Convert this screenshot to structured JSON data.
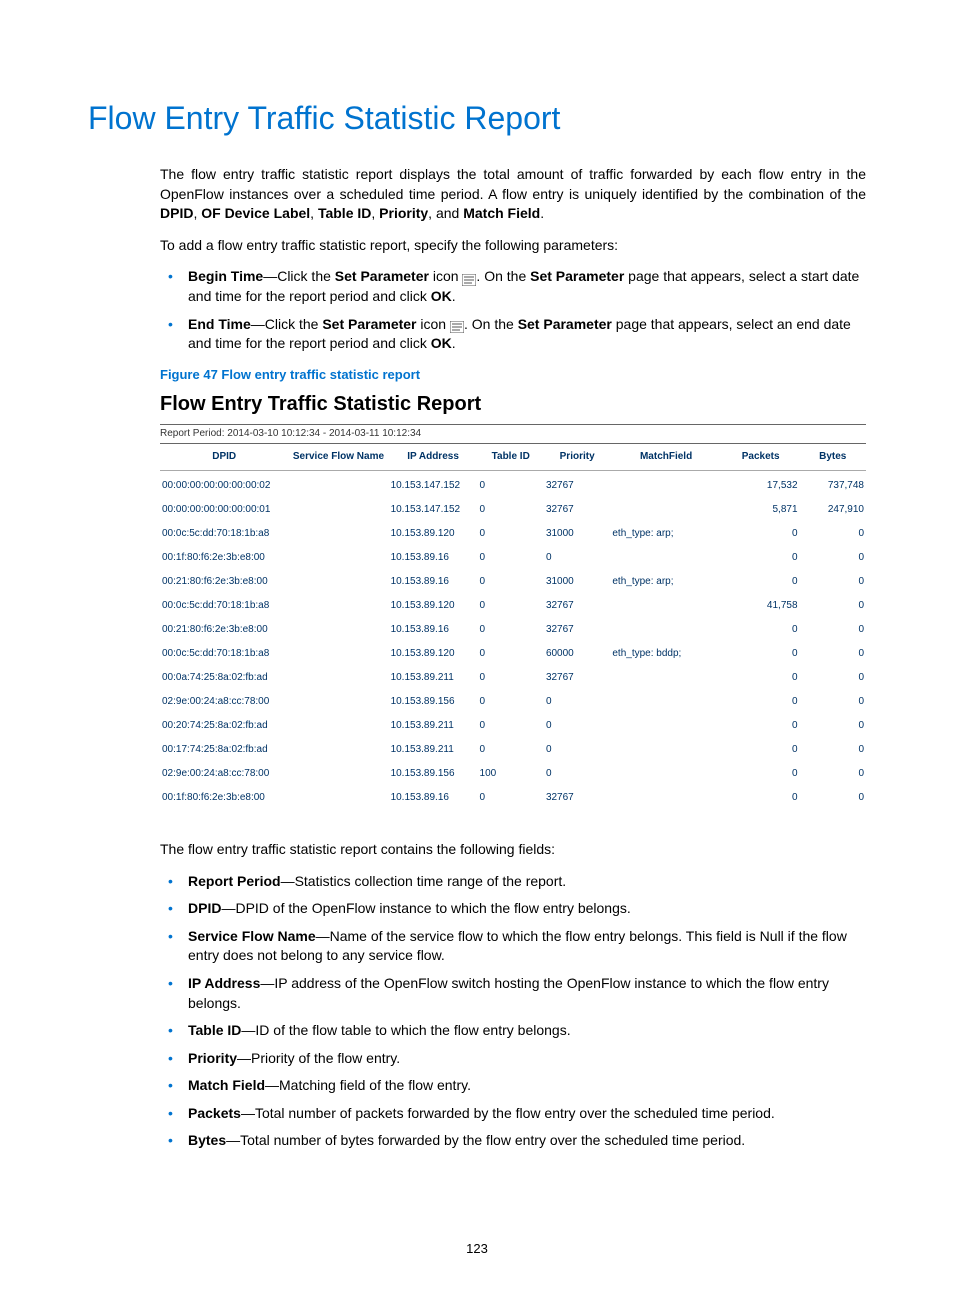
{
  "page_number": "123",
  "title": "Flow Entry Traffic Statistic Report",
  "intro_text": "The flow entry traffic statistic report displays the total amount of traffic forwarded by each flow entry in the OpenFlow instances over a scheduled time period. A flow entry is uniquely identified by the combination of the ",
  "intro_bold": [
    "DPID",
    "OF Device Label",
    "Table ID",
    "Priority",
    "Match Field"
  ],
  "intro_sep": [
    ", ",
    ", ",
    ", ",
    ", and ",
    "."
  ],
  "add_intro": "To add a flow entry traffic statistic report, specify the following parameters:",
  "params": {
    "begin": {
      "label": "Begin Time",
      "text1": "—Click the ",
      "text2": " icon ",
      "text3": ". On the ",
      "text4": " page that appears, select a start date and time for the report period and click ",
      "bold1": "Set Parameter",
      "bold2": "Set Parameter",
      "bold3": "OK",
      "end": "."
    },
    "end": {
      "label": "End Time",
      "text1": "—Click the ",
      "text2": " icon ",
      "text3": ". On the ",
      "text4": " page that appears, select an end date and time for the report period and click ",
      "bold1": "Set Parameter",
      "bold2": "Set Parameter",
      "bold3": "OK",
      "end": "."
    }
  },
  "figure_caption": "Figure 47 Flow entry traffic statistic report",
  "report": {
    "heading": "Flow Entry Traffic Statistic Report",
    "period": "Report Period: 2014-03-10 10:12:34  -  2014-03-11 10:12:34",
    "columns": [
      "DPID",
      "Service Flow Name",
      "IP  Address",
      "Table ID",
      "Priority",
      "MatchField",
      "Packets",
      "Bytes"
    ],
    "rows": [
      {
        "dpid": "00:00:00:00:00:00:00:02",
        "svc": "",
        "ip": "10.153.147.152",
        "tid": "0",
        "prio": "32767",
        "match": "",
        "pkt": "17,532",
        "bytes": "737,748"
      },
      {
        "dpid": "00:00:00:00:00:00:00:01",
        "svc": "",
        "ip": "10.153.147.152",
        "tid": "0",
        "prio": "32767",
        "match": "",
        "pkt": "5,871",
        "bytes": "247,910"
      },
      {
        "dpid": "00:0c:5c:dd:70:18:1b:a8",
        "svc": "",
        "ip": "10.153.89.120",
        "tid": "0",
        "prio": "31000",
        "match": "eth_type: arp;",
        "pkt": "0",
        "bytes": "0"
      },
      {
        "dpid": "00:1f:80:f6:2e:3b:e8:00",
        "svc": "",
        "ip": "10.153.89.16",
        "tid": "0",
        "prio": "0",
        "match": "",
        "pkt": "0",
        "bytes": "0"
      },
      {
        "dpid": "00:21:80:f6:2e:3b:e8:00",
        "svc": "",
        "ip": "10.153.89.16",
        "tid": "0",
        "prio": "31000",
        "match": "eth_type: arp;",
        "pkt": "0",
        "bytes": "0"
      },
      {
        "dpid": "00:0c:5c:dd:70:18:1b:a8",
        "svc": "",
        "ip": "10.153.89.120",
        "tid": "0",
        "prio": "32767",
        "match": "",
        "pkt": "41,758",
        "bytes": "0"
      },
      {
        "dpid": "00:21:80:f6:2e:3b:e8:00",
        "svc": "",
        "ip": "10.153.89.16",
        "tid": "0",
        "prio": "32767",
        "match": "",
        "pkt": "0",
        "bytes": "0"
      },
      {
        "dpid": "00:0c:5c:dd:70:18:1b:a8",
        "svc": "",
        "ip": "10.153.89.120",
        "tid": "0",
        "prio": "60000",
        "match": "eth_type: bddp;",
        "pkt": "0",
        "bytes": "0"
      },
      {
        "dpid": "00:0a:74:25:8a:02:fb:ad",
        "svc": "",
        "ip": "10.153.89.211",
        "tid": "0",
        "prio": "32767",
        "match": "",
        "pkt": "0",
        "bytes": "0"
      },
      {
        "dpid": "02:9e:00:24:a8:cc:78:00",
        "svc": "",
        "ip": "10.153.89.156",
        "tid": "0",
        "prio": "0",
        "match": "",
        "pkt": "0",
        "bytes": "0"
      },
      {
        "dpid": "00:20:74:25:8a:02:fb:ad",
        "svc": "",
        "ip": "10.153.89.211",
        "tid": "0",
        "prio": "0",
        "match": "",
        "pkt": "0",
        "bytes": "0"
      },
      {
        "dpid": "00:17:74:25:8a:02:fb:ad",
        "svc": "",
        "ip": "10.153.89.211",
        "tid": "0",
        "prio": "0",
        "match": "",
        "pkt": "0",
        "bytes": "0"
      },
      {
        "dpid": "02:9e:00:24:a8:cc:78:00",
        "svc": "",
        "ip": "10.153.89.156",
        "tid": "100",
        "prio": "0",
        "match": "",
        "pkt": "0",
        "bytes": "0"
      },
      {
        "dpid": "00:1f:80:f6:2e:3b:e8:00",
        "svc": "",
        "ip": "10.153.89.16",
        "tid": "0",
        "prio": "32767",
        "match": "",
        "pkt": "0",
        "bytes": "0"
      }
    ]
  },
  "fields_intro": "The flow entry traffic statistic report contains the following fields:",
  "fields": [
    {
      "label": "Report Period",
      "desc": "—Statistics collection time range of the report."
    },
    {
      "label": "DPID",
      "desc": "—DPID of the OpenFlow instance to which the flow entry belongs."
    },
    {
      "label": "Service Flow Name",
      "desc": "—Name of the service flow to which the flow entry belongs. This field is Null if the flow entry does not belong to any service flow."
    },
    {
      "label": "IP Address",
      "desc": "—IP address of the OpenFlow switch hosting the OpenFlow instance to which the flow entry belongs."
    },
    {
      "label": "Table ID",
      "desc": "—ID of the flow table to which the flow entry belongs."
    },
    {
      "label": "Priority",
      "desc": "—Priority of the flow entry."
    },
    {
      "label": "Match Field",
      "desc": "—Matching field of the flow entry."
    },
    {
      "label": "Packets",
      "desc": "—Total number of packets forwarded by the flow entry over the scheduled time period."
    },
    {
      "label": "Bytes",
      "desc": "—Total number of bytes forwarded by the flow entry over the scheduled time period."
    }
  ]
}
